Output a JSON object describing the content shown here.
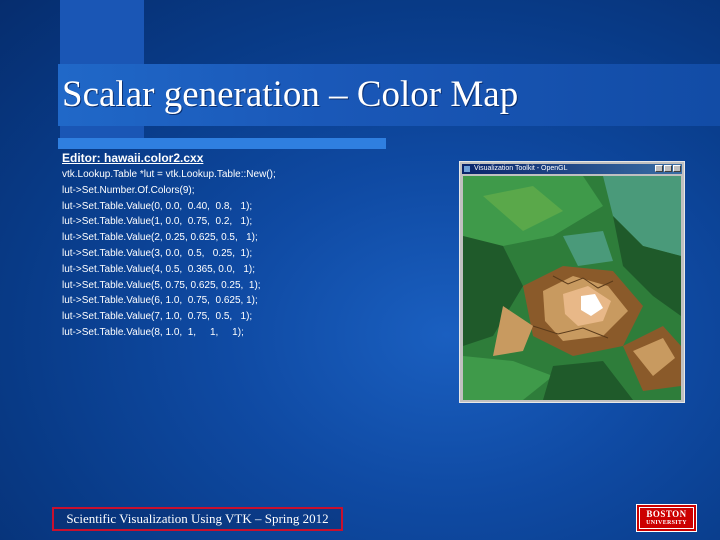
{
  "slide": {
    "title": "Scalar generation – Color Map",
    "editor_heading": "Editor: hawaii.color2.cxx",
    "code_lines": [
      "vtk.Lookup.Table *lut = vtk.Lookup.Table::New();",
      "lut->Set.Number.Of.Colors(9);",
      "lut->Set.Table.Value(0, 0.0,  0.40,  0.8,   1);",
      "lut->Set.Table.Value(1, 0.0,  0.75,  0.2,   1);",
      "lut->Set.Table.Value(2, 0.25, 0.625, 0.5,   1);",
      "lut->Set.Table.Value(3, 0.0,  0.5,   0.25,  1);",
      "lut->Set.Table.Value(4, 0.5,  0.365, 0.0,   1);",
      "lut->Set.Table.Value(5, 0.75, 0.625, 0.25,  1);",
      "lut->Set.Table.Value(6, 1.0,  0.75,  0.625, 1);",
      "lut->Set.Table.Value(7, 1.0,  0.75,  0.5,   1);",
      "lut->Set.Table.Value(8, 1.0,  1,     1,     1);"
    ],
    "footer": "Scientific Visualization Using VTK – Spring 2012"
  },
  "render_window": {
    "title": "Visualization Toolkit - OpenGL",
    "terrain_colors": {
      "deep_green": "#2e7d3a",
      "green": "#3f9a4a",
      "dark_green": "#1f5a2a",
      "teal": "#4a9a7a",
      "brown": "#8a5a2a",
      "tan": "#c89a60",
      "peach": "#e8b888",
      "white": "#ffffff"
    }
  },
  "logo": {
    "line1": "BOSTON",
    "line2": "UNIVERSITY",
    "color": "#cc0000"
  },
  "colors": {
    "background": "#0f4aa3",
    "accent_band": "#1a58b8",
    "accent_line": "#2f7fe0",
    "footer_border": "#c8102e"
  }
}
